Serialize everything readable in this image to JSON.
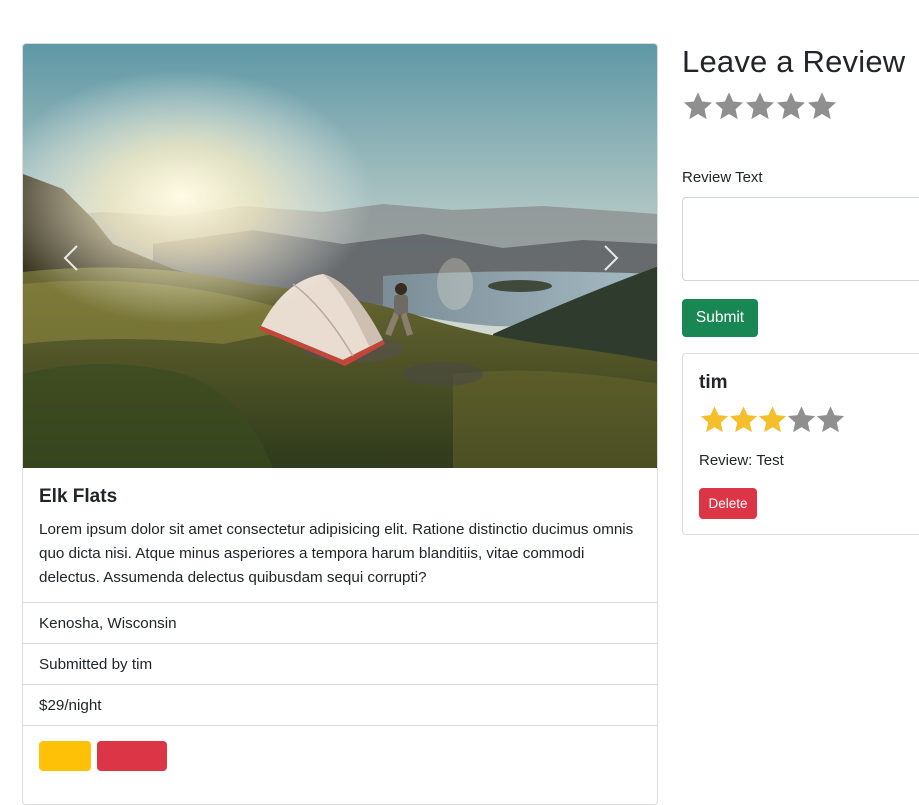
{
  "campground": {
    "title": "Elk Flats",
    "description": "Lorem ipsum dolor sit amet consectetur adipisicing elit. Ratione distinctio ducimus omnis quo dicta nisi. Atque minus asperiores a tempora harum blanditiis, vitae commodi delectus. Assumenda delectus quibusdam sequi corrupti?",
    "location": "Kenosha, Wisconsin",
    "submitted_by": "Submitted by tim",
    "price": "$29/night",
    "image_alt": "tent on mountain ridge at sunset"
  },
  "carousel": {
    "prev_icon": "chevron-left-icon",
    "next_icon": "chevron-right-icon"
  },
  "review_form": {
    "heading": "Leave a Review",
    "rating_value": 0,
    "rating_max": 5,
    "text_label": "Review Text",
    "text_value": "",
    "submit_label": "Submit"
  },
  "reviews": [
    {
      "author": "tim",
      "rating": 3,
      "rating_max": 5,
      "body": "Review: Test",
      "delete_label": "Delete"
    }
  ],
  "colors": {
    "star_filled": "#f5be2b",
    "star_empty": "#8f8f8f",
    "submit": "#198754",
    "danger": "#dc3545",
    "warning": "#ffc107"
  }
}
